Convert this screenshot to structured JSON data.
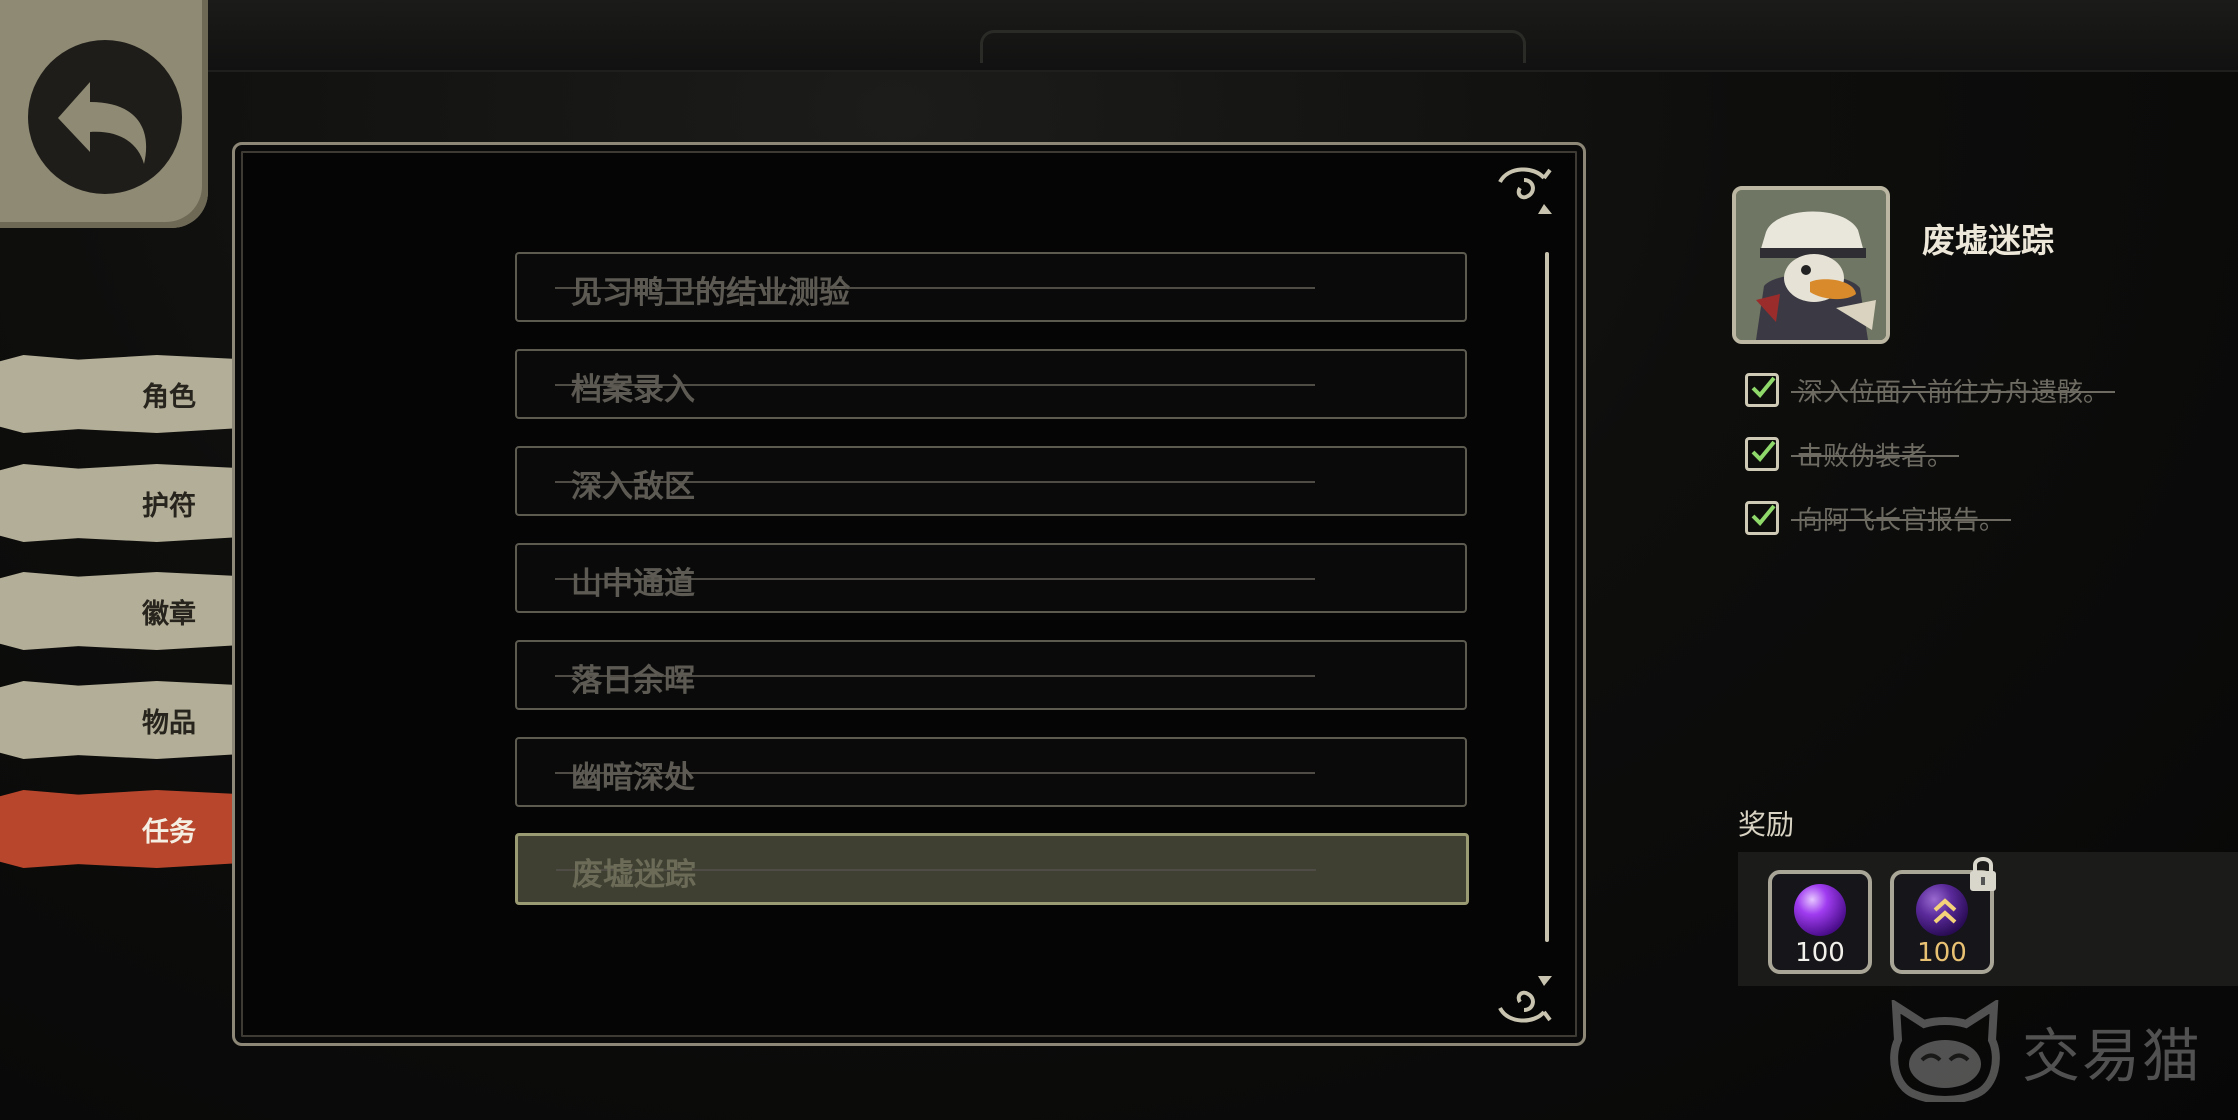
{
  "nav": {
    "back_label": "",
    "tabs": [
      {
        "label": "角色",
        "active": false
      },
      {
        "label": "护符",
        "active": false
      },
      {
        "label": "徽章",
        "active": false
      },
      {
        "label": "物品",
        "active": false
      },
      {
        "label": "任务",
        "active": true
      }
    ]
  },
  "quest_list": {
    "items": [
      {
        "label": "见习鸭卫的结业测验",
        "completed": true,
        "selected": false
      },
      {
        "label": "档案录入",
        "completed": true,
        "selected": false
      },
      {
        "label": "深入敌区",
        "completed": true,
        "selected": false
      },
      {
        "label": "山中通道",
        "completed": true,
        "selected": false
      },
      {
        "label": "落日余晖",
        "completed": true,
        "selected": false
      },
      {
        "label": "幽暗深处",
        "completed": true,
        "selected": false
      },
      {
        "label": "废墟迷踪",
        "completed": true,
        "selected": true
      }
    ]
  },
  "detail": {
    "title": "废墟迷踪",
    "objectives": [
      {
        "text": "深入位面六前往方舟遗骸。",
        "done": true
      },
      {
        "text": "击败伪装者。",
        "done": true
      },
      {
        "text": "向阿飞长官报告。",
        "done": true
      }
    ],
    "rewards_label": "奖励",
    "rewards": [
      {
        "amount": "100",
        "icon": "purple-orb-icon",
        "locked": false
      },
      {
        "amount": "100",
        "icon": "dark-purple-orb-upgrade-icon",
        "locked": true
      }
    ]
  },
  "watermark": {
    "text": "交易猫"
  },
  "colors": {
    "active_tab": "#b8462c",
    "tab": "#b3ae97",
    "panel_border": "#8c8776",
    "selected_quest": "#3f4031"
  }
}
